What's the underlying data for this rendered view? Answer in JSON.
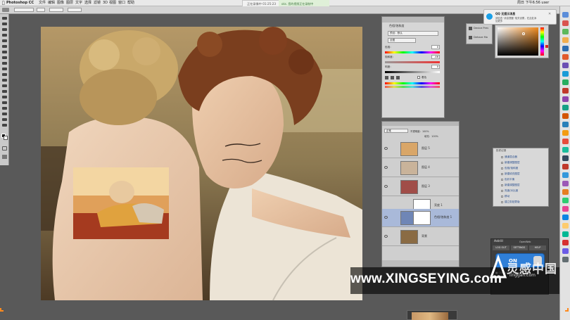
{
  "menubar": {
    "apple": "",
    "app": "Photoshop CC",
    "items": [
      "文件",
      "编辑",
      "图像",
      "图层",
      "文字",
      "选择",
      "滤镜",
      "3D",
      "视图",
      "窗口",
      "帮助"
    ],
    "right": "周日 下午6:56 user"
  },
  "recording": {
    "timer": "正在录像中 01:25:23",
    "note": "oks. 您的视频正在录制中"
  },
  "notification": {
    "title": "QQ 无提示消息",
    "body": "请检查 '消息提醒' 相关设置，在此处添加更多"
  },
  "panels": {
    "adjust_title": "色相/饱和度",
    "adjust_preset": "预设：默认",
    "adjust_channel": "全图",
    "hue_label": "色相：",
    "hue_value": "0",
    "sat_label": "饱和度：",
    "sat_value": "-46",
    "light_label": "明度：",
    "light_value": "0",
    "colorize_label": "着色"
  },
  "layers": {
    "mode": "正常",
    "opacity": "不透明度：100%",
    "fill": "填充：100%",
    "rows": [
      {
        "name": "图层 5"
      },
      {
        "name": "图层 4"
      },
      {
        "name": "图层 3"
      },
      {
        "name": "亮度 1"
      },
      {
        "name": "色相/饱和度 1"
      },
      {
        "name": "背景"
      }
    ]
  },
  "side_list": {
    "title": "历史记录",
    "items": [
      "通道混合器",
      "新建调整图层",
      "色相/饱和度",
      "新建填充图层",
      "色彩平衡",
      "新建调整图层",
      "亮度/对比度",
      "移动",
      "建立剪贴蒙版"
    ]
  },
  "small_panel": {
    "item1": "Device Prev",
    "item2": "Dehaze Mo"
  },
  "astrill": {
    "title": "Astrill",
    "sub": "OpenWeb",
    "tabs": [
      "LOG OUT",
      "SETTINGS",
      "HELP"
    ],
    "toggle": "ON",
    "server": "■ China Fastconnect"
  },
  "watermark": {
    "text": "www.XINGSEYING.com",
    "sub_text": "linggan.com",
    "badge": "灵感中国"
  },
  "colors": {
    "accent": "#ff8a1e",
    "selected_layer": "#a9b9d9",
    "astrill_on": "#2f7fd8"
  }
}
